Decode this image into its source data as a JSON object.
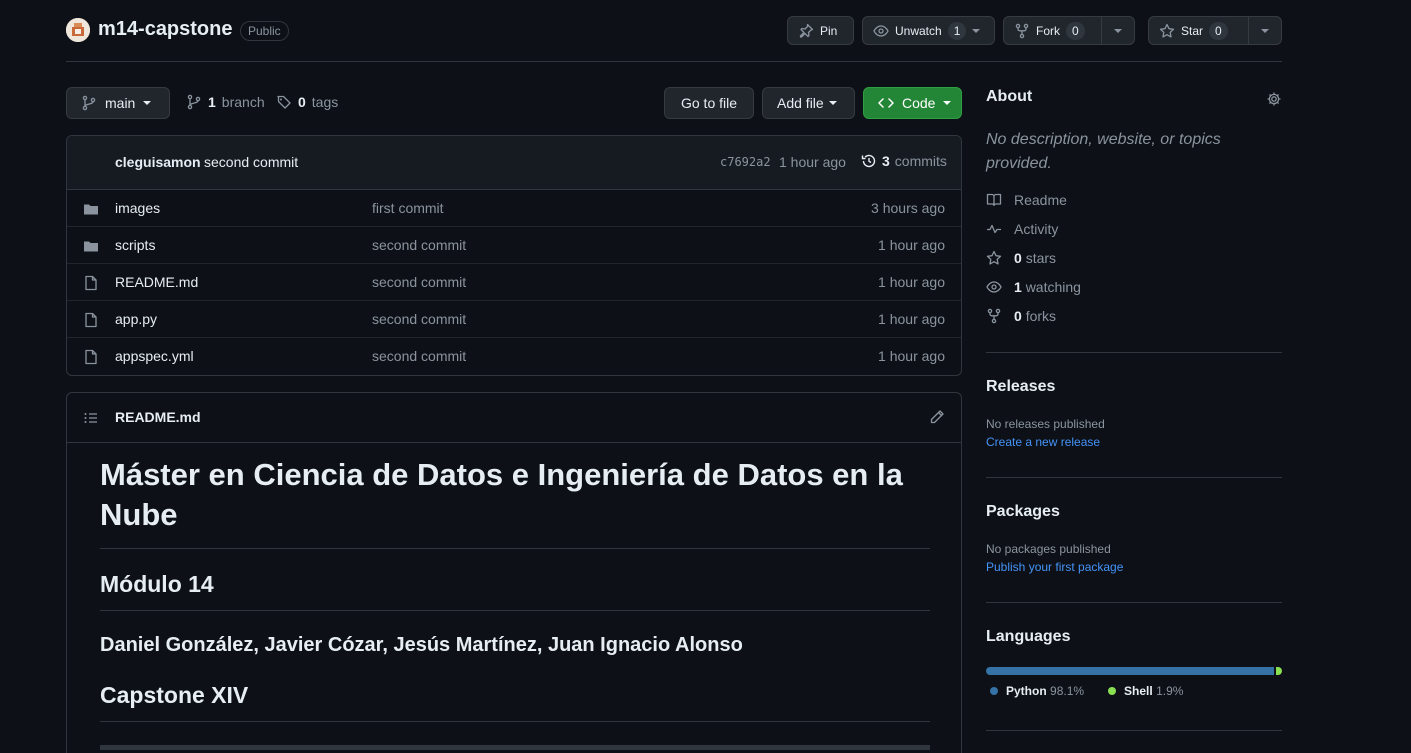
{
  "repo": {
    "name": "m14-capstone",
    "visibility": "Public",
    "pin_label": "Pin",
    "unwatch_label": "Unwatch",
    "watch_count": "1",
    "fork_label": "Fork",
    "fork_count": "0",
    "star_label": "Star",
    "star_count": "0"
  },
  "branch_bar": {
    "branch": "main",
    "branches_count": "1",
    "branches_label": "branch",
    "tags_count": "0",
    "tags_label": "tags",
    "go_to_file": "Go to file",
    "add_file": "Add file",
    "code": "Code"
  },
  "latest_commit": {
    "author": "cleguisamon",
    "message": "second commit",
    "sha": "c7692a2",
    "time": "1 hour ago",
    "commits_count": "3",
    "commits_label": "commits"
  },
  "files": [
    {
      "name": "images",
      "type": "folder",
      "message": "first commit",
      "time": "3 hours ago"
    },
    {
      "name": "scripts",
      "type": "folder",
      "message": "second commit",
      "time": "1 hour ago"
    },
    {
      "name": "README.md",
      "type": "file",
      "message": "second commit",
      "time": "1 hour ago"
    },
    {
      "name": "app.py",
      "type": "file",
      "message": "second commit",
      "time": "1 hour ago"
    },
    {
      "name": "appspec.yml",
      "type": "file",
      "message": "second commit",
      "time": "1 hour ago"
    }
  ],
  "readme": {
    "filename": "README.md",
    "h1": "Máster en Ciencia de Datos e Ingeniería de Datos en la Nube",
    "h2": "Módulo 14",
    "authors": "Daniel González, Javier Cózar, Jesús Martínez, Juan Ignacio Alonso",
    "h2b": "Capstone XIV"
  },
  "about": {
    "title": "About",
    "description": "No description, website, or topics provided.",
    "readme": "Readme",
    "activity": "Activity",
    "stars_count": "0",
    "stars_label": "stars",
    "watching_count": "1",
    "watching_label": "watching",
    "forks_count": "0",
    "forks_label": "forks"
  },
  "releases": {
    "title": "Releases",
    "empty": "No releases published",
    "link": "Create a new release"
  },
  "packages": {
    "title": "Packages",
    "empty": "No packages published",
    "link": "Publish your first package"
  },
  "languages": {
    "title": "Languages",
    "items": [
      {
        "name": "Python",
        "percent": "98.1%",
        "value": 98.1,
        "color": "#3572A5"
      },
      {
        "name": "Shell",
        "percent": "1.9%",
        "value": 1.9,
        "color": "#89e051"
      }
    ]
  },
  "colors": {
    "accent_green": "#238636",
    "link_blue": "#4493f8",
    "bg": "#0d1117"
  }
}
